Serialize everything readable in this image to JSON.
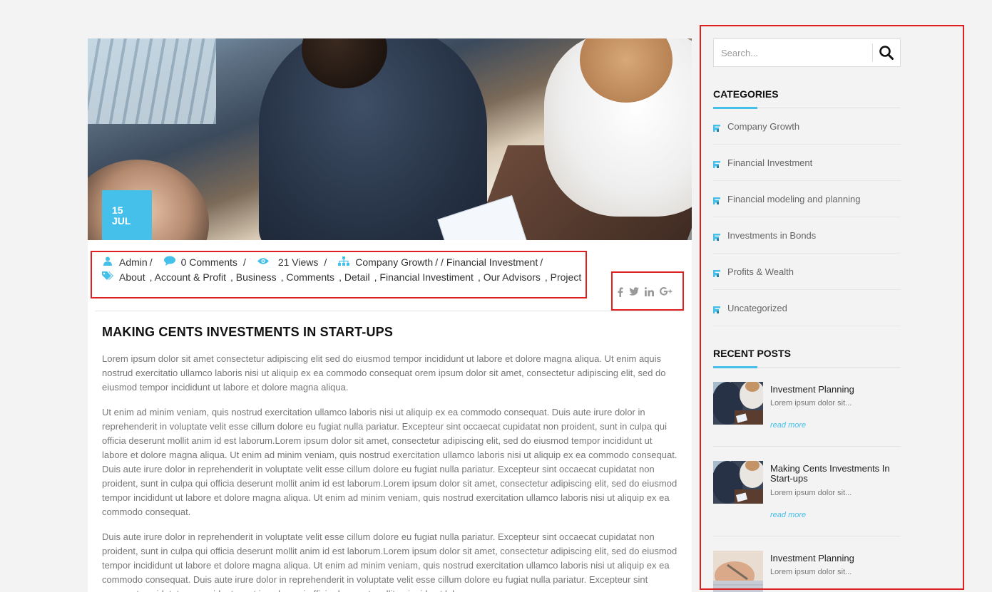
{
  "post": {
    "date_day": "15",
    "date_month": "JUL",
    "author": "Admin",
    "comments": "0 Comments",
    "views": "21 Views",
    "categories": [
      "Company Growth",
      "Financial Investment"
    ],
    "tags": [
      "About",
      "Account & Profit",
      "Business",
      "Comments",
      "Detail",
      "Financial Investiment",
      "Our Advisors",
      "Project"
    ],
    "title": "MAKING CENTS INVESTMENTS IN START-UPS",
    "paragraphs": [
      "Lorem ipsum dolor sit amet consectetur adipiscing elit sed do eiusmod tempor incididunt ut labore et dolore magna aliqua. Ut enim aquis nostrud exercitatio ullamco laboris nisi ut aliquip ex ea commodo consequat orem ipsum dolor sit amet, consectetur adipiscing elit, sed do eiusmod tempor incididunt ut labore et dolore magna aliqua.",
      "Ut enim ad minim veniam, quis nostrud exercitation ullamco laboris nisi ut aliquip ex ea commodo consequat. Duis aute irure dolor in reprehenderit in voluptate velit esse cillum dolore eu fugiat nulla pariatur. Excepteur sint occaecat cupidatat non proident, sunt in culpa qui officia deserunt mollit anim id est laborum.Lorem ipsum dolor sit amet, consectetur adipiscing elit, sed do eiusmod tempor incididunt ut labore et dolore magna aliqua. Ut enim ad minim veniam, quis nostrud exercitation ullamco laboris nisi ut aliquip ex ea commodo consequat. Duis aute irure dolor in reprehenderit in voluptate velit esse cillum dolore eu fugiat nulla pariatur. Excepteur sint occaecat cupidatat non proident, sunt in culpa qui officia deserunt mollit anim id est laborum.Lorem ipsum dolor sit amet, consectetur adipiscing elit, sed do eiusmod tempor incididunt ut labore et dolore magna aliqua. Ut enim ad minim veniam, quis nostrud exercitation ullamco laboris nisi ut aliquip ex ea commodo consequat.",
      "Duis aute irure dolor in reprehenderit in voluptate velit esse cillum dolore eu fugiat nulla pariatur. Excepteur sint occaecat cupidatat non proident, sunt in culpa qui officia deserunt mollit anim id est laborum.Lorem ipsum dolor sit amet, consectetur adipiscing elit, sed do eiusmod tempor incididunt ut labore et dolore magna aliqua. Ut enim ad minim veniam, quis nostrud exercitation ullamco laboris nisi ut aliquip ex ea commodo consequat. Duis aute irure dolor in reprehenderit in voluptate velit esse cillum dolore eu fugiat nulla pariatur. Excepteur sint occaecat cupidatat non proident, sunt in culpa qui officia deserunt mollit anim id est laborum."
    ],
    "social": [
      "facebook-icon",
      "twitter-icon",
      "linkedin-icon",
      "google-plus-icon"
    ]
  },
  "sidebar": {
    "search_placeholder": "Search...",
    "categories_title": "CATEGORIES",
    "categories": [
      "Company Growth",
      "Financial Investment",
      "Financial modeling and planning",
      "Investments in Bonds",
      "Profits & Wealth",
      "Uncategorized"
    ],
    "recent_title": "RECENT POSTS",
    "recent_posts": [
      {
        "title": "Investment Planning",
        "excerpt": "Lorem ipsum dolor sit...",
        "more": "read more"
      },
      {
        "title": "Making Cents Investments In Start-ups",
        "excerpt": "Lorem ipsum dolor sit...",
        "more": "read more"
      },
      {
        "title": "Investment Planning",
        "excerpt": "Lorem ipsum dolor sit..."
      }
    ]
  },
  "colors": {
    "accent": "#45c0ea",
    "annotation": "#e02020"
  }
}
